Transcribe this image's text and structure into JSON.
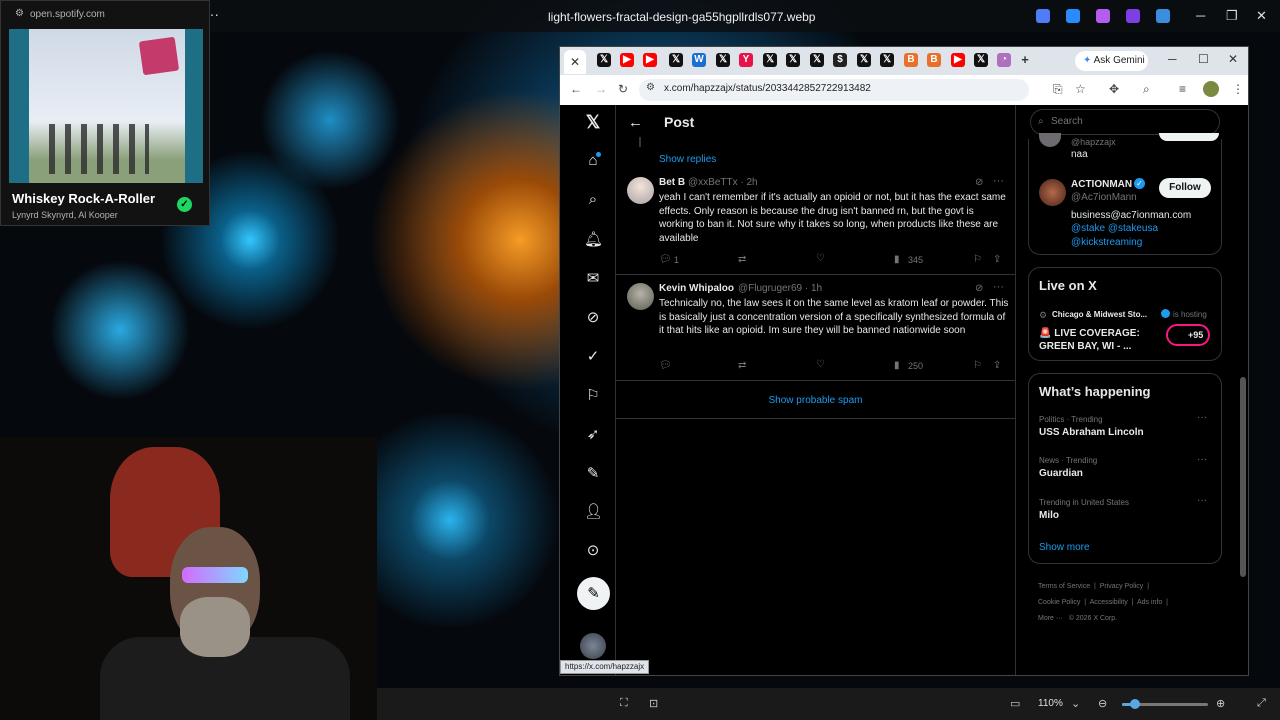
{
  "window": {
    "title": "light-flowers-fractal-design-ga55hgpllrdls077.webp"
  },
  "spotify": {
    "url": "open.spotify.com",
    "song": "Whiskey Rock-A-Roller",
    "artist": "Lynyrd Skynyrd, Al Kooper"
  },
  "browser": {
    "gemini_label": "Ask Gemini",
    "url": "x.com/hapzzajx/status/2033442852722913482",
    "status_link": "https://x.com/hapzzajx"
  },
  "post": {
    "title": "Post",
    "show_replies": "Show replies",
    "show_spam": "Show probable spam",
    "tweets": [
      {
        "name": "Bet B",
        "handle": "@xxBeTTx · 2h",
        "text": "yeah I can't remember if it's actually an opioid or not, but it has the exact same effects. Only reason is because the drug isn't banned rn, but the govt is working to ban it. Not sure why it takes so long, when products like these are available",
        "replies": "1",
        "views": "345"
      },
      {
        "name": "Kevin Whipaloo",
        "handle": "@Flugruger69 · 1h",
        "text": "Technically no, the law sees it on the same level as kratom leaf or powder. This is basically just a concentration version of a specifically synthesized formula of it that hits like an opioid. Im sure they will be banned nationwide soon",
        "replies": "",
        "views": "250"
      }
    ]
  },
  "sidebar": {
    "search_placeholder": "Search",
    "partial_handle": "@hapzzajx",
    "partial_text": "naa",
    "follow_card": {
      "name": "ACTIONMAN",
      "handle": "@Ac7ionMann",
      "follow": "Follow",
      "email": "business@ac7ionman.com",
      "line2": "@stake @stakeusa",
      "line3": "@kickstreaming"
    },
    "live": {
      "title": "Live on X",
      "host": "Chicago & Midwest Sto...",
      "hosting": "is hosting",
      "headline1": "🚨 LIVE COVERAGE:",
      "headline2": "GREEN BAY, WI - ...",
      "count": "+95"
    },
    "happening": {
      "title": "What’s happening",
      "items": [
        {
          "meta": "Politics · Trending",
          "topic": "USS Abraham Lincoln"
        },
        {
          "meta": "News · Trending",
          "topic": "Guardian"
        },
        {
          "meta": "Trending in United States",
          "topic": "Milo"
        }
      ],
      "show_more": "Show more"
    },
    "footer": {
      "terms": "Terms of Service",
      "privacy": "Privacy Policy",
      "cookie": "Cookie Policy",
      "accessibility": "Accessibility",
      "ads": "Ads info",
      "more": "More ···",
      "copyright": "© 2026 X Corp."
    }
  },
  "viewer": {
    "zoom": "110%",
    "zoom_fraction": 0.15
  },
  "colors": {
    "accent": "#1d9bf0",
    "bg": "#000000"
  }
}
